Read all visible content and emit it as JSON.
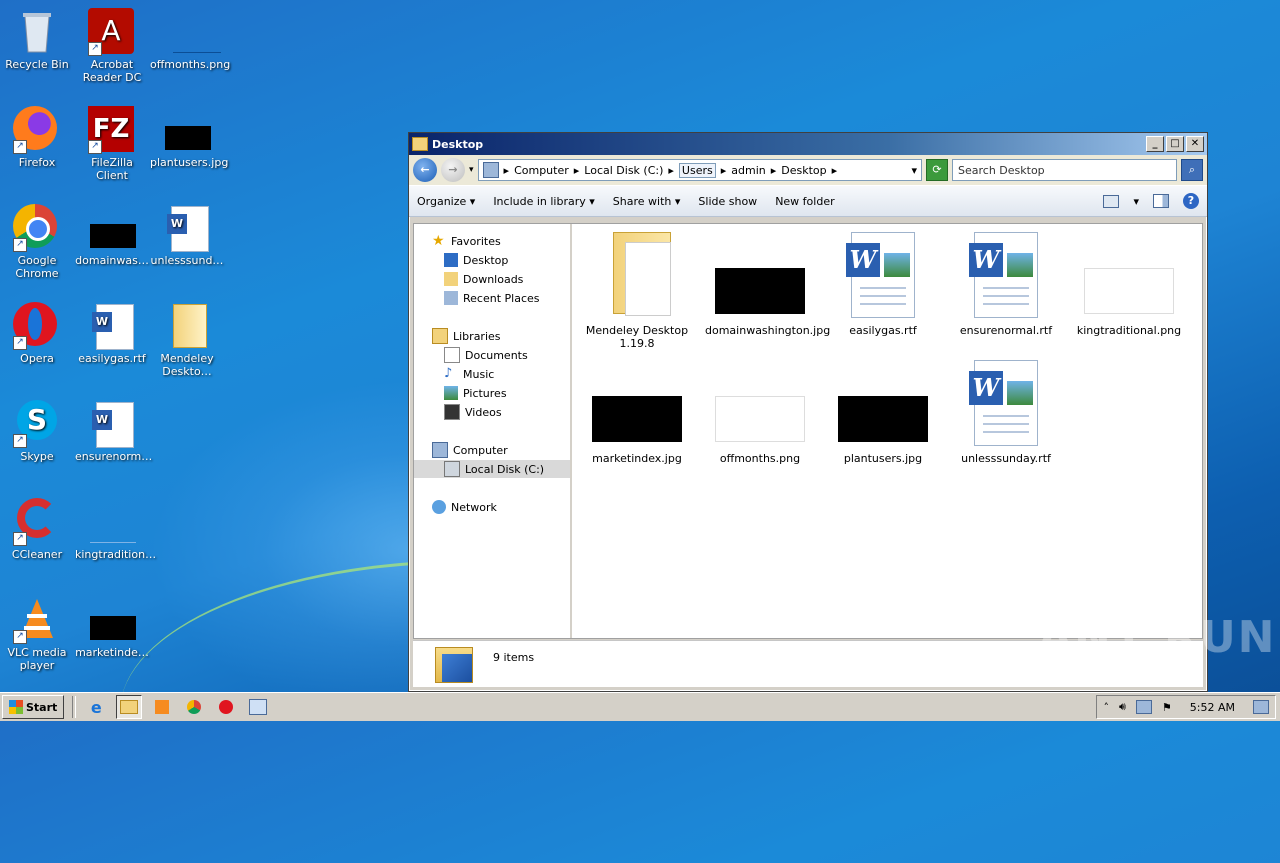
{
  "desktop": {
    "icons": [
      {
        "label": "Recycle Bin",
        "icon": "recycle-bin-icon"
      },
      {
        "label": "Acrobat Reader DC",
        "icon": "acrobat-icon"
      },
      {
        "label": "offmonths.png",
        "icon": "png-thumbnail"
      },
      {
        "label": "Firefox",
        "icon": "firefox-icon"
      },
      {
        "label": "FileZilla Client",
        "icon": "filezilla-icon"
      },
      {
        "label": "plantusers.jpg",
        "icon": "jpg-thumbnail"
      },
      {
        "label": "Google Chrome",
        "icon": "chrome-icon"
      },
      {
        "label": "domainwas…",
        "icon": "jpg-thumbnail"
      },
      {
        "label": "unlesssund…",
        "icon": "word-icon"
      },
      {
        "label": "Opera",
        "icon": "opera-icon"
      },
      {
        "label": "easilygas.rtf",
        "icon": "word-icon"
      },
      {
        "label": "Mendeley Deskto…",
        "icon": "folder-icon"
      },
      {
        "label": "Skype",
        "icon": "skype-icon"
      },
      {
        "label": "ensurenorm…",
        "icon": "word-icon"
      },
      {
        "label": "CCleaner",
        "icon": "ccleaner-icon"
      },
      {
        "label": "kingtradition…",
        "icon": "png-thumbnail"
      },
      {
        "label": "VLC media player",
        "icon": "vlc-icon"
      },
      {
        "label": "marketinde…",
        "icon": "jpg-thumbnail"
      }
    ]
  },
  "window": {
    "title": "Desktop",
    "address": {
      "segments": [
        "Computer",
        "Local Disk (C:)",
        "Users",
        "admin",
        "Desktop"
      ]
    },
    "search_placeholder": "Search Desktop",
    "toolbar": {
      "organize": "Organize",
      "include_in_library": "Include in library",
      "share_with": "Share with",
      "slide_show": "Slide show",
      "new_folder": "New folder"
    },
    "nav": {
      "favorites": "Favorites",
      "desktop": "Desktop",
      "downloads": "Downloads",
      "recent_places": "Recent Places",
      "libraries": "Libraries",
      "documents": "Documents",
      "music": "Music",
      "pictures": "Pictures",
      "videos": "Videos",
      "computer": "Computer",
      "local_disk": "Local Disk (C:)",
      "network": "Network"
    },
    "files": [
      {
        "name": "Mendeley Desktop 1.19.8",
        "type": "folder"
      },
      {
        "name": "domainwashington.jpg",
        "type": "jpg"
      },
      {
        "name": "easilygas.rtf",
        "type": "rtf"
      },
      {
        "name": "ensurenormal.rtf",
        "type": "rtf"
      },
      {
        "name": "kingtraditional.png",
        "type": "png"
      },
      {
        "name": "marketindex.jpg",
        "type": "jpg"
      },
      {
        "name": "offmonths.png",
        "type": "png"
      },
      {
        "name": "plantusers.jpg",
        "type": "jpg"
      },
      {
        "name": "unlesssunday.rtf",
        "type": "rtf"
      }
    ],
    "status": "9 items"
  },
  "taskbar": {
    "start_label": "Start",
    "clock": "5:52 AM"
  },
  "watermark": "ANY RUN"
}
